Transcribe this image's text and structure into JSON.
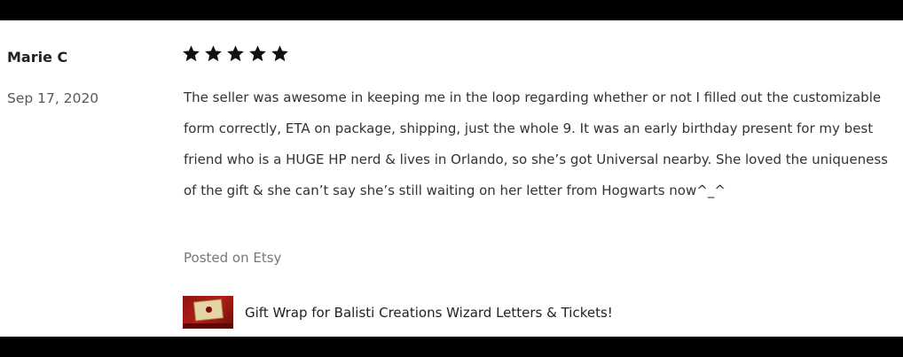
{
  "review": {
    "reviewer": "Marie C",
    "date": "Sep 17, 2020",
    "rating": 5,
    "text": "The seller was awesome in keeping me in the loop regarding whether or not I filled out the customizable form correctly, ETA on package, shipping, just the whole 9. It was an early birthday present for my best friend who is a HUGE HP nerd & lives in Orlando, so she’s got Universal nearby. She loved the uniqueness of the gift & she can’t say she’s still waiting on her letter from Hogwarts now^_^",
    "source": "Posted on Etsy",
    "product": {
      "title": "Gift Wrap for Balisti Creations Wizard Letters & Tickets!",
      "thumbnail_icon": "product-thumbnail"
    }
  },
  "colors": {
    "star": "#111111",
    "text": "#333333",
    "muted": "#777777",
    "date": "#595959",
    "frame": "#000000",
    "thumb_red": "#b11e18"
  },
  "icons": {
    "star": "star-icon"
  }
}
